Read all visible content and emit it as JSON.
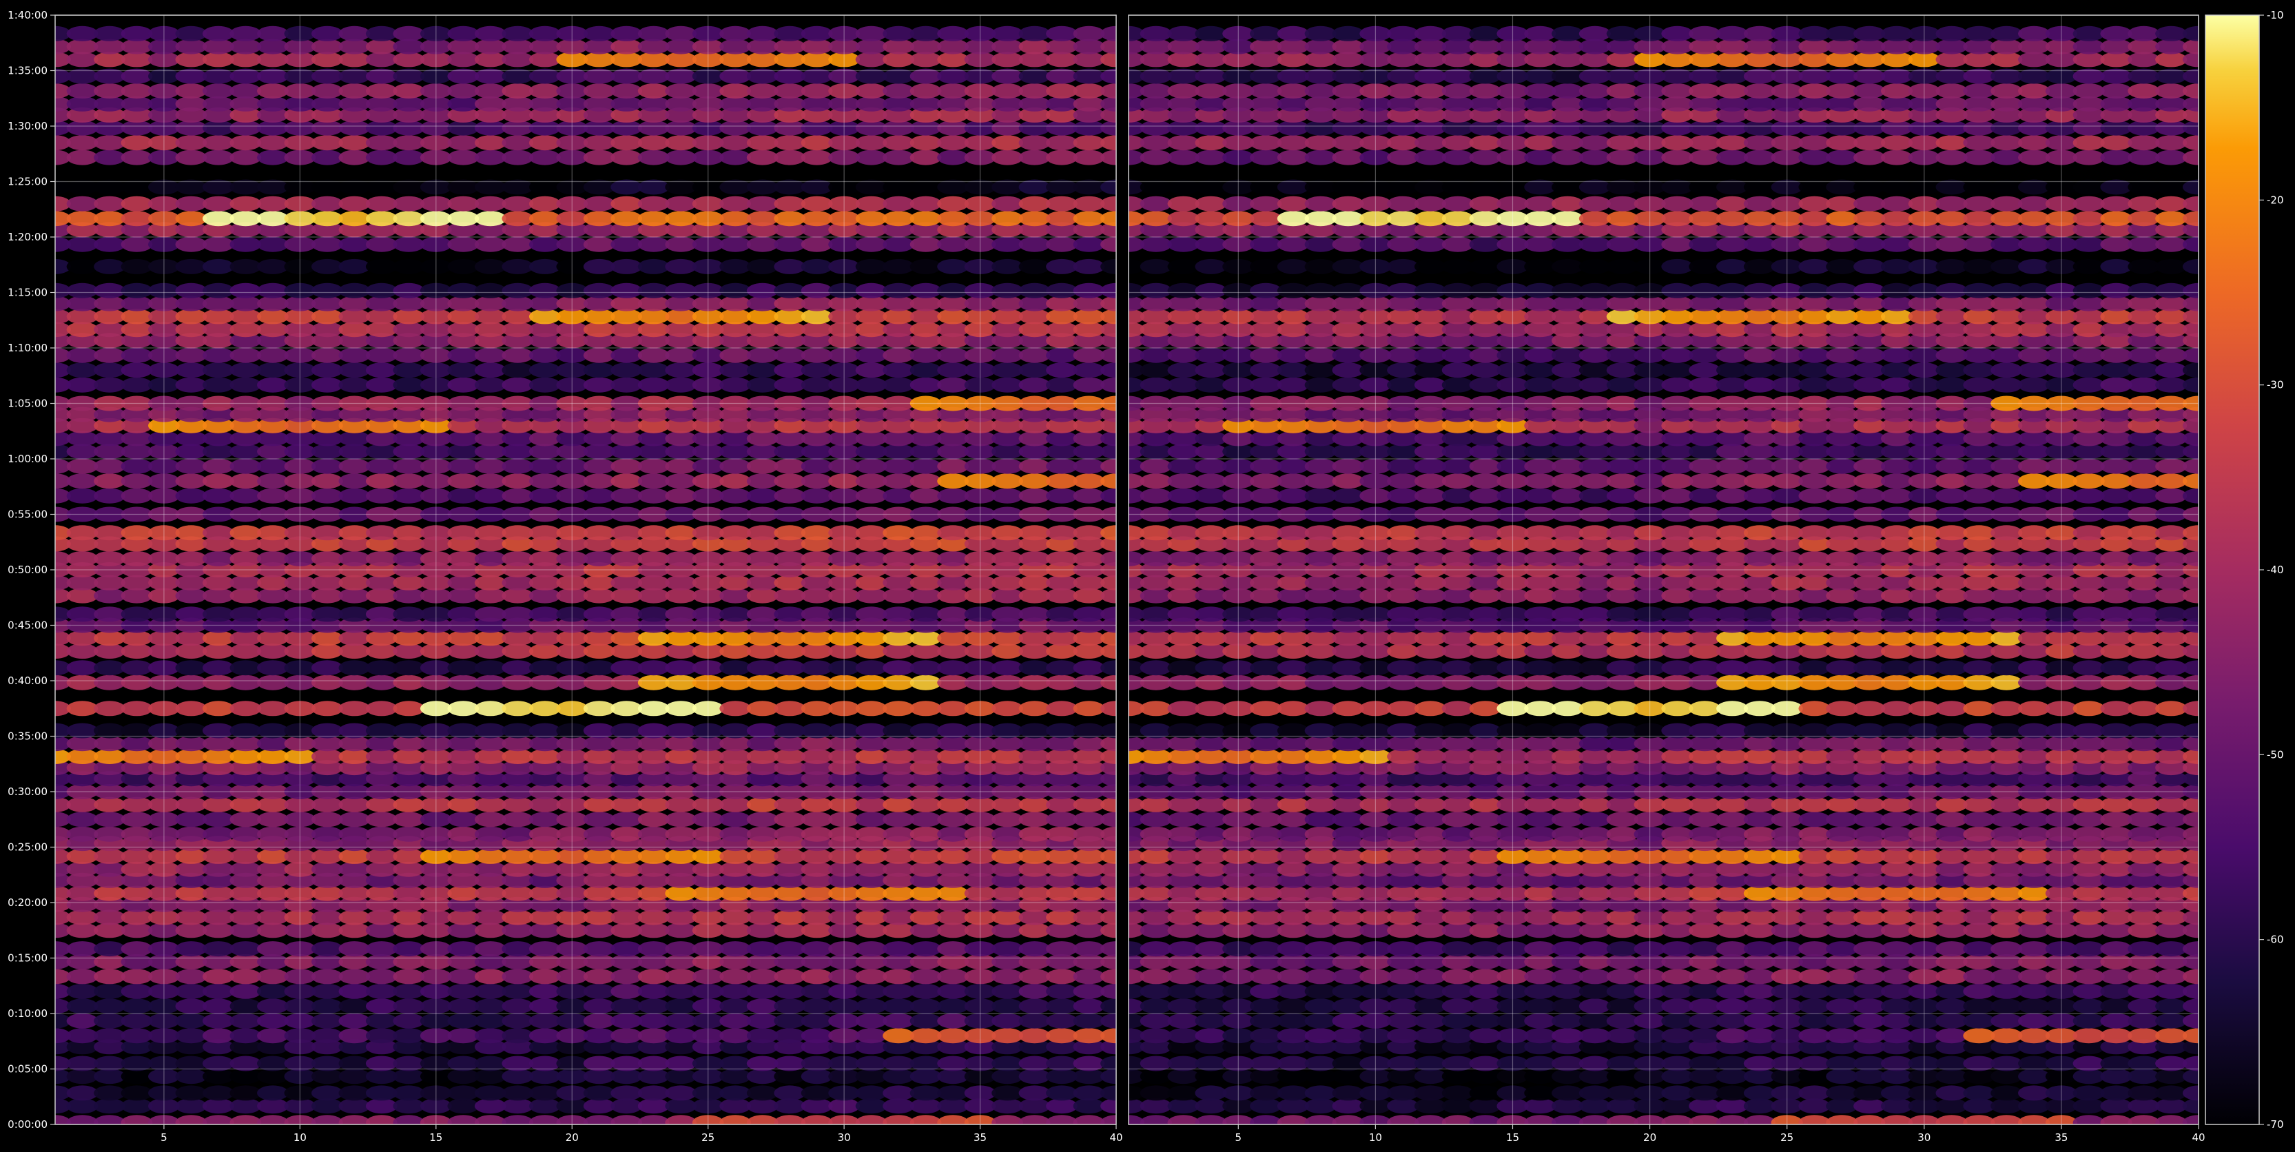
{
  "chart_data": {
    "type": "heatmap",
    "title": "",
    "xlabel": "",
    "ylabel": "",
    "grid": true,
    "panels": [
      {
        "xlim": [
          1,
          40
        ],
        "xticks": [
          "5",
          "10",
          "15",
          "20",
          "25",
          "30",
          "35",
          "40"
        ]
      },
      {
        "xlim": [
          1,
          40
        ],
        "xticks": [
          "5",
          "10",
          "15",
          "20",
          "25",
          "30",
          "35",
          "40"
        ]
      }
    ],
    "y_axis": {
      "unit": "elapsed time (h:mm:ss)",
      "ylim_seconds": [
        0,
        6000
      ],
      "ticks": [
        "0:00:00",
        "0:05:00",
        "0:10:00",
        "0:15:00",
        "0:20:00",
        "0:25:00",
        "0:30:00",
        "0:35:00",
        "0:40:00",
        "0:45:00",
        "0:50:00",
        "0:55:00",
        "1:00:00",
        "1:05:00",
        "1:10:00",
        "1:15:00",
        "1:20:00",
        "1:25:00",
        "1:30:00",
        "1:35:00",
        "1:40:00"
      ]
    },
    "colorbar": {
      "colormap": "inferno",
      "range": [
        -70,
        -10
      ],
      "ticks": [
        "-10",
        "-20",
        "-30",
        "-40",
        "-50",
        "-60",
        "-70"
      ]
    },
    "rows": [
      {
        "t": 10,
        "level": -46,
        "hot_x": 30
      },
      {
        "t": 100,
        "level": -60
      },
      {
        "t": 170,
        "level": -64
      },
      {
        "t": 260,
        "level": -66
      },
      {
        "t": 330,
        "level": -60
      },
      {
        "t": 420,
        "level": -62
      },
      {
        "t": 480,
        "level": -56,
        "hot_x": 37,
        "hot_level": -32
      },
      {
        "t": 560,
        "level": -58
      },
      {
        "t": 640,
        "level": -60
      },
      {
        "t": 720,
        "level": -58
      },
      {
        "t": 800,
        "level": -44
      },
      {
        "t": 880,
        "level": -46
      },
      {
        "t": 950,
        "level": -54
      },
      {
        "t": 1050,
        "level": -42
      },
      {
        "t": 1120,
        "level": -38
      },
      {
        "t": 1190,
        "level": -44
      },
      {
        "t": 1250,
        "level": -36,
        "hot_x": 29,
        "hot_level": -26
      },
      {
        "t": 1320,
        "level": -48
      },
      {
        "t": 1380,
        "level": -42
      },
      {
        "t": 1450,
        "level": -34,
        "hot_x": 20,
        "hot_level": -26
      },
      {
        "t": 1520,
        "level": -44
      },
      {
        "t": 1570,
        "level": -46
      },
      {
        "t": 1650,
        "level": -48
      },
      {
        "t": 1730,
        "level": -36
      },
      {
        "t": 1800,
        "level": -48
      },
      {
        "t": 1870,
        "level": -54
      },
      {
        "t": 1930,
        "level": -44
      },
      {
        "t": 1990,
        "level": -36,
        "hot_x": 5,
        "hot_level": -24
      },
      {
        "t": 2060,
        "level": -48
      },
      {
        "t": 2130,
        "level": -62
      },
      {
        "t": 2250,
        "level": -32,
        "hot_x": 20,
        "hot_level": -14
      },
      {
        "t": 2390,
        "level": -42,
        "hot_x": 28,
        "hot_level": -22
      },
      {
        "t": 2470,
        "level": -60
      },
      {
        "t": 2560,
        "level": -36
      },
      {
        "t": 2630,
        "level": -34,
        "hot_x": 28,
        "hot_level": -22
      },
      {
        "t": 2700,
        "level": -50
      },
      {
        "t": 2760,
        "level": -56
      },
      {
        "t": 2860,
        "level": -42
      },
      {
        "t": 2930,
        "level": -40
      },
      {
        "t": 3000,
        "level": -38
      },
      {
        "t": 3060,
        "level": -44
      },
      {
        "t": 3140,
        "level": -34
      },
      {
        "t": 3200,
        "level": -34
      },
      {
        "t": 3300,
        "level": -50
      },
      {
        "t": 3400,
        "level": -52
      },
      {
        "t": 3480,
        "level": -44,
        "hot_x": 39,
        "hot_level": -26
      },
      {
        "t": 3560,
        "level": -50
      },
      {
        "t": 3640,
        "level": -56
      },
      {
        "t": 3710,
        "level": -52
      },
      {
        "t": 3780,
        "level": -38,
        "hot_x": 10,
        "hot_level": -26
      },
      {
        "t": 3840,
        "level": -46
      },
      {
        "t": 3900,
        "level": -42,
        "hot_x": 38,
        "hot_level": -26
      },
      {
        "t": 4000,
        "level": -58
      },
      {
        "t": 4080,
        "level": -60
      },
      {
        "t": 4160,
        "level": -52
      },
      {
        "t": 4240,
        "level": -44
      },
      {
        "t": 4300,
        "level": -38
      },
      {
        "t": 4370,
        "level": -34,
        "hot_x": 24,
        "hot_level": -22
      },
      {
        "t": 4440,
        "level": -46
      },
      {
        "t": 4510,
        "level": -60
      },
      {
        "t": 4640,
        "level": -66
      },
      {
        "t": 4760,
        "level": -52
      },
      {
        "t": 4840,
        "level": -42
      },
      {
        "t": 4900,
        "level": -28,
        "hot_x": 12,
        "hot_level": -14
      },
      {
        "t": 4980,
        "level": -40
      },
      {
        "t": 5070,
        "level": -68
      },
      {
        "t": 5230,
        "level": -48
      },
      {
        "t": 5310,
        "level": -40
      },
      {
        "t": 5390,
        "level": -54
      },
      {
        "t": 5460,
        "level": -42
      },
      {
        "t": 5520,
        "level": -50
      },
      {
        "t": 5590,
        "level": -44
      },
      {
        "t": 5670,
        "level": -58
      },
      {
        "t": 5760,
        "level": -40,
        "hot_x": 25,
        "hot_level": -26
      },
      {
        "t": 5830,
        "level": -46
      },
      {
        "t": 5900,
        "level": -56
      }
    ]
  }
}
